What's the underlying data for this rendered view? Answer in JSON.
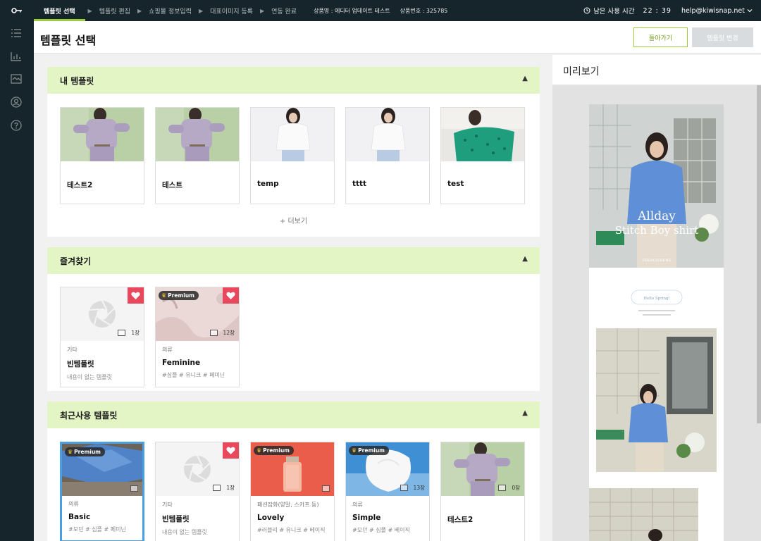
{
  "topbar": {
    "steps": [
      {
        "label": "템플릿 선택",
        "active": true
      },
      {
        "label": "템플릿 편집",
        "active": false
      },
      {
        "label": "쇼핑몰 정보입력",
        "active": false
      },
      {
        "label": "대표이미지 등록",
        "active": false
      },
      {
        "label": "연동 완료",
        "active": false
      }
    ],
    "product_name": "상품명 : 에디터 업데이트 테스트",
    "product_id": "상품번호 : 325785",
    "time_label": "남은 사용 시간",
    "time_value": "22 : 39",
    "email": "help@kiwisnap.net"
  },
  "sidebar": {
    "icons": [
      "list-icon",
      "chart-icon",
      "image-check-icon",
      "user-circle-icon",
      "help-icon"
    ]
  },
  "header": {
    "title": "템플릿 선택",
    "back_label": "돌아가기",
    "change_label": "템플릿 변경"
  },
  "my_templates": {
    "title": "내 템플릿",
    "more_label": "+ 더보기",
    "items": [
      {
        "name": "테스트2",
        "thumb": "lavender-set"
      },
      {
        "name": "테스트",
        "thumb": "lavender-set"
      },
      {
        "name": "temp",
        "thumb": "white-knit"
      },
      {
        "name": "tttt",
        "thumb": "white-knit"
      },
      {
        "name": "test",
        "thumb": "green-knit"
      }
    ]
  },
  "favorites": {
    "title": "즐겨찾기",
    "items": [
      {
        "category": "기타",
        "name": "빈템플릿",
        "tags": "내용이 없는 템플릿",
        "count": "1장",
        "premium": false,
        "thumb": "empty"
      },
      {
        "category": "의류",
        "name": "Feminine",
        "tags": "#심플 # 유니크 # 페미닌",
        "count": "12장",
        "premium": true,
        "thumb": "pink-shadow"
      }
    ]
  },
  "recent": {
    "title": "최근사용 템플릿",
    "items": [
      {
        "category": "의류",
        "name": "Basic",
        "tags": "#모던 # 심플 # 페미닌",
        "count": "",
        "premium": true,
        "heart": false,
        "selected": true,
        "thumb": "blue-shirt"
      },
      {
        "category": "기타",
        "name": "빈템플릿",
        "tags": "내용이 없는 템플릿",
        "count": "1장",
        "premium": false,
        "heart": true,
        "selected": false,
        "thumb": "empty"
      },
      {
        "category": "패션잡화(양말, 스카프 등)",
        "name": "Lovely",
        "tags": "#러블리 # 유니크 # 베이직",
        "count": "",
        "premium": true,
        "heart": false,
        "selected": false,
        "thumb": "red-bottle"
      },
      {
        "category": "의류",
        "name": "Simple",
        "tags": "#모던 # 심플 # 베이직",
        "count": "13장",
        "premium": true,
        "heart": false,
        "selected": false,
        "thumb": "white-dress"
      },
      {
        "category": "",
        "name": "테스트2",
        "tags": "",
        "count": "0장",
        "premium": false,
        "heart": false,
        "selected": false,
        "thumb": "lavender-set"
      }
    ]
  },
  "badge_label": "Premium",
  "preview": {
    "title": "미리보기",
    "hero_line1": "Allday",
    "hero_line2": "Stitch Boy shirt",
    "hero_caption": "FRENCH RENE",
    "greeting": "Hello Spring!"
  },
  "colors": {
    "accent_green": "#9ccc3c",
    "section_header": "#e3f4c5",
    "dark_nav": "#16242b",
    "heart_red": "#e9475b",
    "selected_blue": "#4a9fe0"
  }
}
